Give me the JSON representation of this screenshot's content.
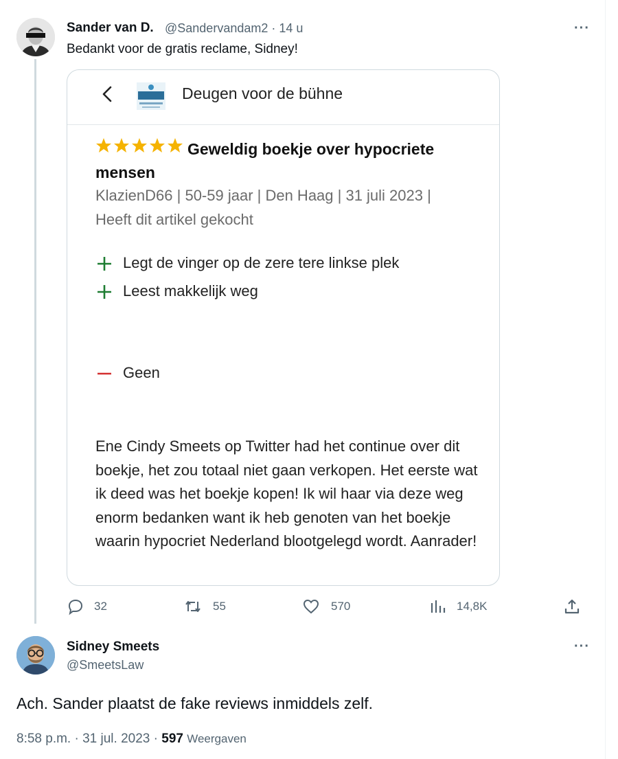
{
  "tweet1": {
    "author_name": "Sander van D.",
    "handle": "@Sandervandam2",
    "separator": "·",
    "time": "14 u",
    "text": "Bedankt voor de gratis reclame, Sidney!",
    "more_label": "···",
    "quoted": {
      "header_title": "Deugen voor de bühne",
      "logo_text": "DEUGEN",
      "logo_subtext": "voor de bühne",
      "rating_stars": 5,
      "review_title": "Geweldig boekje over hypocriete mensen",
      "meta_line1": "KlazienD66 | 50-59 jaar | Den Haag | 31 juli 2023 |",
      "meta_line2": "Heeft dit artikel gekocht",
      "pros": [
        "Legt de vinger op de zere tere linkse plek",
        "Leest makkelijk weg"
      ],
      "cons": [
        "Geen"
      ],
      "body": "Ene Cindy Smeets op Twitter had het continue over dit boekje, het zou totaal niet gaan verkopen. Het eerste wat ik deed was het boekje kopen! Ik wil haar via deze weg enorm bedanken want ik heb genoten van het boekje waarin hypocriet Nederland blootgelegd wordt. Aanrader!",
      "colors": {
        "star": "#f5b301",
        "plus": "#1e7d32",
        "minus": "#d32f2f"
      }
    },
    "actions": {
      "replies": "32",
      "retweets": "55",
      "likes": "570",
      "views": "14,8K"
    }
  },
  "tweet2": {
    "author_name": "Sidney Smeets",
    "handle": "@SmeetsLaw",
    "more_label": "···",
    "text": "Ach. Sander plaatst de fake reviews inmiddels zelf.",
    "time": "8:58 p.m.",
    "separator": "·",
    "date": "31 jul. 2023",
    "views_count": "597",
    "views_label": "Weergaven"
  }
}
